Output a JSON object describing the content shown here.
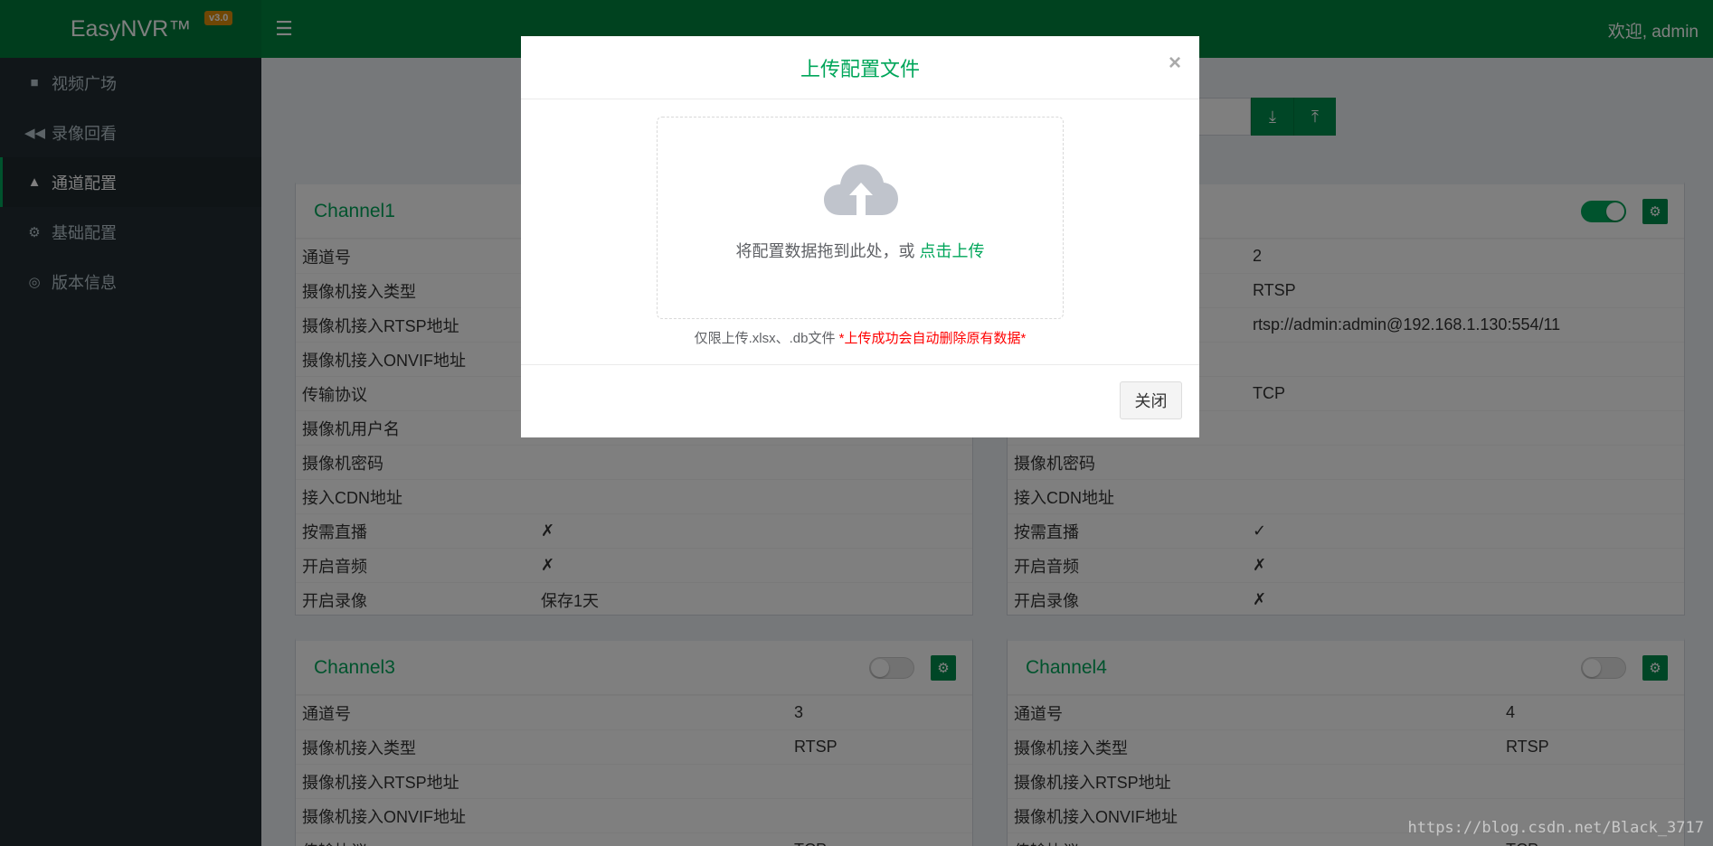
{
  "header": {
    "brand": "EasyNVR™",
    "version": "v3.0",
    "menu_icon": "hamburger-icon",
    "welcome": "欢迎, admin"
  },
  "sidebar": {
    "items": [
      {
        "label": "视频广场",
        "icon": "video-camera-icon",
        "active": false
      },
      {
        "label": "录像回看",
        "icon": "backward-icon",
        "active": false
      },
      {
        "label": "通道配置",
        "icon": "road-icon",
        "active": true
      },
      {
        "label": "基础配置",
        "icon": "gears-icon",
        "active": false
      },
      {
        "label": "版本信息",
        "icon": "life-ring-icon",
        "active": false
      }
    ]
  },
  "toolbar": {
    "download_icon": "download-icon",
    "upload_icon": "upload-icon"
  },
  "channels": [
    {
      "title": "Channel1",
      "rows": [
        {
          "k": "通道号",
          "v": ""
        },
        {
          "k": "摄像机接入类型",
          "v": ""
        },
        {
          "k": "摄像机接入RTSP地址",
          "v": ""
        },
        {
          "k": "摄像机接入ONVIF地址",
          "v": ""
        },
        {
          "k": "传输协议",
          "v": ""
        },
        {
          "k": "摄像机用户名",
          "v": ""
        },
        {
          "k": "摄像机密码",
          "v": ""
        },
        {
          "k": "接入CDN地址",
          "v": ""
        },
        {
          "k": "按需直播",
          "v": "✗"
        },
        {
          "k": "开启音频",
          "v": "✗"
        },
        {
          "k": "开启录像",
          "v": "保存1天"
        }
      ]
    },
    {
      "title": "",
      "enabled": true,
      "rows": [
        {
          "k": "",
          "v": "2"
        },
        {
          "k": "",
          "v": "RTSP"
        },
        {
          "k": "",
          "v": "rtsp://admin:admin@192.168.1.130:554/11"
        },
        {
          "k": "",
          "v": ""
        },
        {
          "k": "",
          "v": "TCP"
        },
        {
          "k": "",
          "v": ""
        },
        {
          "k": "摄像机密码",
          "v": ""
        },
        {
          "k": "接入CDN地址",
          "v": ""
        },
        {
          "k": "按需直播",
          "v": "✓"
        },
        {
          "k": "开启音频",
          "v": "✗"
        },
        {
          "k": "开启录像",
          "v": "✗"
        }
      ]
    },
    {
      "title": "Channel3",
      "enabled": false,
      "rows": [
        {
          "k": "通道号",
          "v": "3"
        },
        {
          "k": "摄像机接入类型",
          "v": "RTSP"
        },
        {
          "k": "摄像机接入RTSP地址",
          "v": ""
        },
        {
          "k": "摄像机接入ONVIF地址",
          "v": ""
        },
        {
          "k": "传输协议",
          "v": "TCP"
        }
      ]
    },
    {
      "title": "Channel4",
      "enabled": false,
      "rows": [
        {
          "k": "通道号",
          "v": "4"
        },
        {
          "k": "摄像机接入类型",
          "v": "RTSP"
        },
        {
          "k": "摄像机接入RTSP地址",
          "v": ""
        },
        {
          "k": "摄像机接入ONVIF地址",
          "v": ""
        },
        {
          "k": "传输协议",
          "v": "TCP"
        }
      ]
    }
  ],
  "modal": {
    "title": "上传配置文件",
    "close_symbol": "×",
    "drop_text": "将配置数据拖到此处，或 ",
    "drop_link": "点击上传",
    "tip": "仅限上传.xlsx、.db文件 ",
    "tip_warn": "*上传成功会自动删除原有数据*",
    "close_button": "关闭",
    "upload_icon": "cloud-upload-icon"
  },
  "watermark": "https://blog.csdn.net/Black_3717",
  "colors": {
    "brand_green": "#00843f",
    "accent": "#00a65a",
    "sidebar_bg": "#222d32",
    "warn": "#ff0000"
  }
}
